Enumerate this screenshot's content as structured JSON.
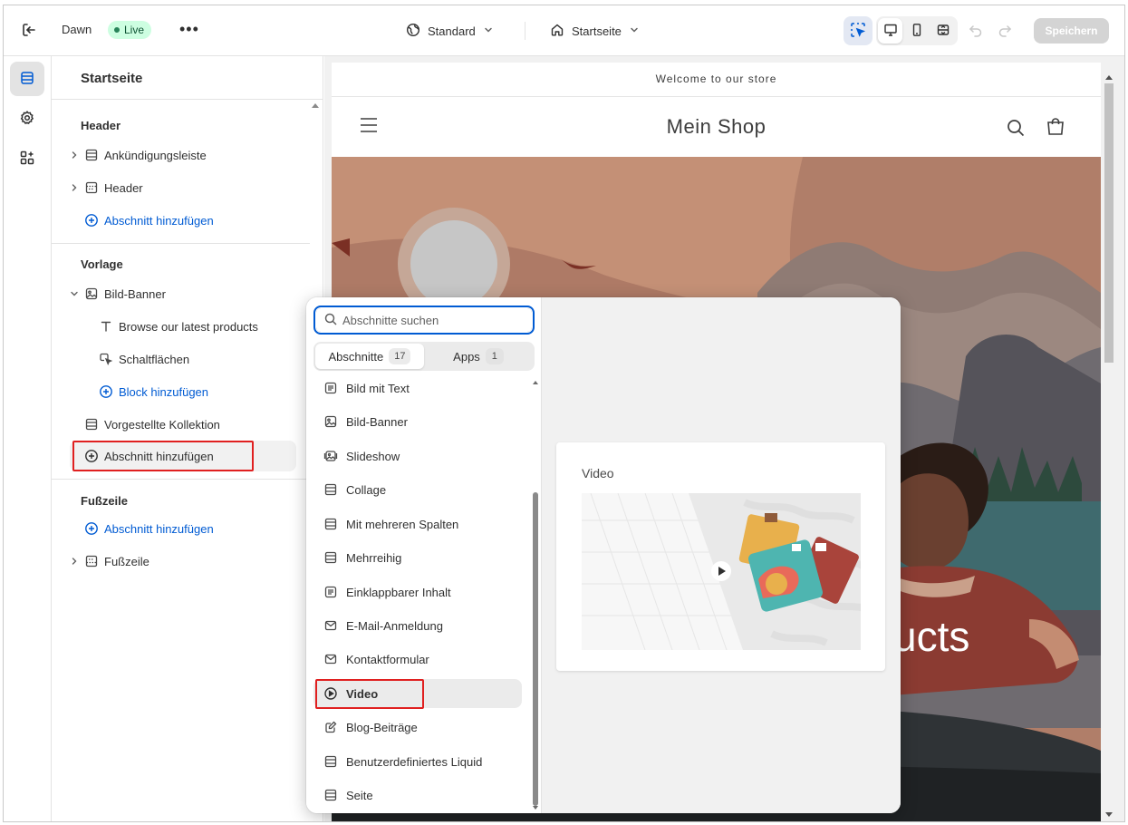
{
  "topbar": {
    "theme_name": "Dawn",
    "live_label": "Live",
    "more_label": "•••",
    "version_label": "Standard",
    "page_label": "Startseite",
    "save_label": "Speichern"
  },
  "sidebar": {
    "title": "Startseite",
    "groups": {
      "header": {
        "title": "Header",
        "items": [
          "Ankündigungsleiste",
          "Header"
        ],
        "add_label": "Abschnitt hinzufügen"
      },
      "template": {
        "title": "Vorlage",
        "banner_label": "Bild-Banner",
        "banner_blocks": [
          "Browse our latest products",
          "Schaltflächen"
        ],
        "add_block_label": "Block hinzufügen",
        "featured_label": "Vorgestellte Kollektion",
        "add_label": "Abschnitt hinzufügen"
      },
      "footer": {
        "title": "Fußzeile",
        "add_label": "Abschnitt hinzufügen",
        "item_label": "Fußzeile"
      }
    }
  },
  "preview": {
    "announcement": "Welcome to our store",
    "logo": "Mein Shop",
    "hero_text": "ucts"
  },
  "picker": {
    "search_placeholder": "Abschnitte suchen",
    "tabs": [
      {
        "label": "Abschnitte",
        "count": "17"
      },
      {
        "label": "Apps",
        "count": "1"
      }
    ],
    "items": [
      {
        "label": "Bild mit Text",
        "icon": "text-block-icon"
      },
      {
        "label": "Bild-Banner",
        "icon": "image-icon"
      },
      {
        "label": "Slideshow",
        "icon": "slideshow-icon"
      },
      {
        "label": "Collage",
        "icon": "layout-icon"
      },
      {
        "label": "Mit mehreren Spalten",
        "icon": "columns-icon"
      },
      {
        "label": "Mehrreihig",
        "icon": "rows-icon"
      },
      {
        "label": "Einklappbarer Inhalt",
        "icon": "text-block-icon"
      },
      {
        "label": "E-Mail-Anmeldung",
        "icon": "email-icon"
      },
      {
        "label": "Kontaktformular",
        "icon": "email-icon"
      },
      {
        "label": "Video",
        "icon": "play-circle-icon"
      },
      {
        "label": "Blog-Beiträge",
        "icon": "edit-icon"
      },
      {
        "label": "Benutzerdefiniertes Liquid",
        "icon": "layout-icon"
      },
      {
        "label": "Seite",
        "icon": "layout-icon"
      }
    ],
    "selected": "Video",
    "preview_title": "Video"
  },
  "colors": {
    "accent_blue": "#005bd3",
    "live_green": "#29845a",
    "highlight_red": "#e02020"
  }
}
